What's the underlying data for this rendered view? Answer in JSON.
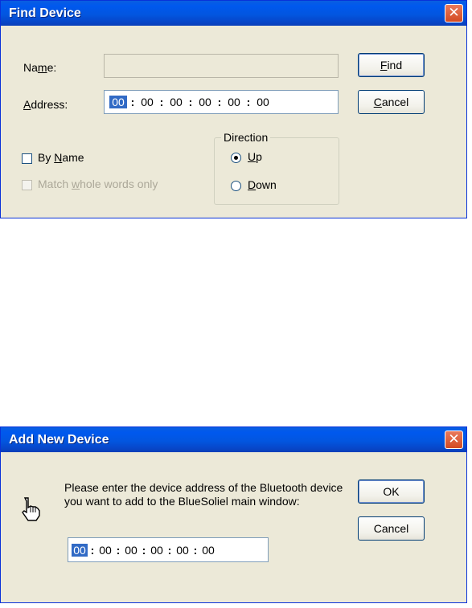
{
  "find_dialog": {
    "title": "Find Device",
    "close_glyph": "✕",
    "name_label_pre": "Na",
    "name_label_u": "m",
    "name_label_post": "e:",
    "address_label_u": "A",
    "address_label_post": "ddress:",
    "address_segments": [
      "00",
      "00",
      "00",
      "00",
      "00",
      "00"
    ],
    "address_separator": ":",
    "find_button": {
      "u": "F",
      "rest": "ind"
    },
    "cancel_button": {
      "u": "C",
      "rest": "ancel"
    },
    "by_name": {
      "pre": "By ",
      "u": "N",
      "post": "ame",
      "checked": false
    },
    "match_whole": {
      "pre": "Match ",
      "u": "w",
      "post": "hole words only",
      "checked": false,
      "enabled": false
    },
    "direction_label": "Direction",
    "up": {
      "u": "U",
      "post": "p",
      "selected": true
    },
    "down": {
      "u": "D",
      "post": "own",
      "selected": false
    }
  },
  "add_dialog": {
    "title": "Add New Device",
    "close_glyph": "✕",
    "icon": "hand-pointer-icon",
    "message": "Please enter the device address of the Bluetooth device you want to add to the BlueSoliel main window:",
    "address_segments": [
      "00",
      "00",
      "00",
      "00",
      "00",
      "00"
    ],
    "address_separator": ":",
    "ok_label": "OK",
    "cancel_label": "Cancel"
  },
  "colors": {
    "titlebar_blue": "#0058ee",
    "dialog_face": "#ece9d8",
    "selection": "#316ac5",
    "close_red": "#d44a22"
  }
}
